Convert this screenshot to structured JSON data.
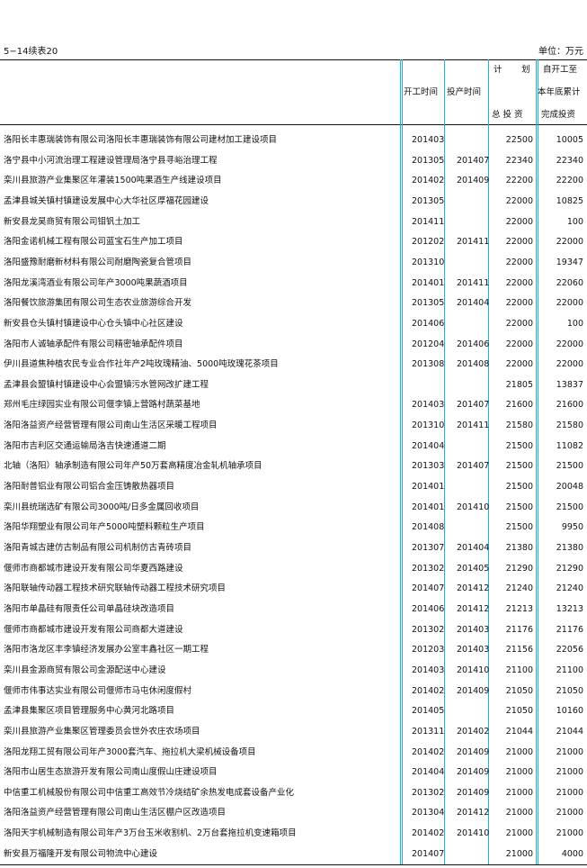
{
  "header": {
    "table_label": "5−14续表20",
    "unit_label": "单位：万元"
  },
  "columns": {
    "start_time": "开工时间",
    "production_time": "投产时间",
    "plan_char1": "计",
    "plan_char2": "划",
    "plan_sub": "总 投 资",
    "cum_line1": "自开工至",
    "cum_line2": "本年底累计",
    "cum_line3": "完成投资"
  },
  "rows": [
    {
      "name": "洛阳长丰惠瑞装饰有限公司洛阳长丰惠瑞装饰有限公司建材加工建设项目",
      "start": "201403",
      "prod": "",
      "total": "22500",
      "done": "10005"
    },
    {
      "name": "洛宁县中小河流治理工程建设管理局洛宁县寻峪治理工程",
      "start": "201305",
      "prod": "201407",
      "total": "22340",
      "done": "22340"
    },
    {
      "name": "栾川县旅游产业集聚区年灌装1500吨果酒生产线建设项目",
      "start": "201402",
      "prod": "201409",
      "total": "22200",
      "done": "22200"
    },
    {
      "name": "孟津县城关镇村镇建设发展中心大华社区厚福花园建设",
      "start": "201305",
      "prod": "",
      "total": "22000",
      "done": "10825"
    },
    {
      "name": "新安县龙昊商贸有限公司钼钒土加工",
      "start": "201411",
      "prod": "",
      "total": "22000",
      "done": "100"
    },
    {
      "name": "洛阳金诺机械工程有限公司蓝宝石生产加工项目",
      "start": "201202",
      "prod": "201411",
      "total": "22000",
      "done": "22000"
    },
    {
      "name": "洛阳盛豫耐磨新材料有限公司耐磨陶瓷复合管项目",
      "start": "201310",
      "prod": "",
      "total": "22000",
      "done": "19347"
    },
    {
      "name": "洛阳龙溪湾酒业有限公司年产3000吨果蔬酒项目",
      "start": "201401",
      "prod": "201411",
      "total": "22000",
      "done": "22060"
    },
    {
      "name": "洛阳餐饮旅游集团有限公司生态农业旅游综合开发",
      "start": "201305",
      "prod": "201404",
      "total": "22000",
      "done": "22000"
    },
    {
      "name": "新安县仓头镇村镇建设中心仓头镇中心社区建设",
      "start": "201406",
      "prod": "",
      "total": "22000",
      "done": "100"
    },
    {
      "name": "洛阳市人诚轴承配件有限公司精密轴承配件项目",
      "start": "201204",
      "prod": "201406",
      "total": "22000",
      "done": "22000"
    },
    {
      "name": "伊川县道焦种植农民专业合作社年产2吨玫瑰精油、5000吨玫瑰花茶项目",
      "start": "201308",
      "prod": "201408",
      "total": "22000",
      "done": "22000"
    },
    {
      "name": "孟津县会盟镇村镇建设中心会盟镇污水管网改扩建工程",
      "start": "",
      "prod": "",
      "total": "21805",
      "done": "13837"
    },
    {
      "name": "郑州毛庄绿园实业有限公司偃李镇上营路村蔬菜基地",
      "start": "201403",
      "prod": "201407",
      "total": "21600",
      "done": "21600"
    },
    {
      "name": "洛阳洛益资产经营管理有限公司南山生活区采暖工程项目",
      "start": "201310",
      "prod": "201411",
      "total": "21580",
      "done": "21580"
    },
    {
      "name": "洛阳市吉利区交通运输局洛吉快速通道二期",
      "start": "201404",
      "prod": "",
      "total": "21500",
      "done": "11082"
    },
    {
      "name": "北轴（洛阳）轴承制造有限公司年产50万套高精度冶金轧机轴承项目",
      "start": "201303",
      "prod": "201407",
      "total": "21500",
      "done": "21500"
    },
    {
      "name": "洛阳耐普铝业有限公司铝合金压铸散热器项目",
      "start": "201401",
      "prod": "",
      "total": "21500",
      "done": "20048"
    },
    {
      "name": "栾川县统瑞选矿有限公司3000吨/日多金属回收项目",
      "start": "201401",
      "prod": "201410",
      "total": "21500",
      "done": "21500"
    },
    {
      "name": "洛阳华翔塑业有限公司年产5000吨塑料颗粒生产项目",
      "start": "201408",
      "prod": "",
      "total": "21500",
      "done": "9950"
    },
    {
      "name": "洛阳青城古建仿古制品有限公司机制仿古青砖项目",
      "start": "201307",
      "prod": "201404",
      "total": "21380",
      "done": "21380"
    },
    {
      "name": "偃师市商都城市建设开发有限公司华夏西路建设",
      "start": "201302",
      "prod": "201405",
      "total": "21290",
      "done": "21290"
    },
    {
      "name": "洛阳联轴传动器工程技术研究联轴传动器工程技术研究项目",
      "start": "201407",
      "prod": "201412",
      "total": "21240",
      "done": "21240"
    },
    {
      "name": "洛阳市单晶硅有限责任公司单晶硅块改造项目",
      "start": "201406",
      "prod": "201412",
      "total": "21213",
      "done": "13213"
    },
    {
      "name": "偃师市商都城市建设开发有限公司商都大道建设",
      "start": "201302",
      "prod": "201403",
      "total": "21176",
      "done": "21176"
    },
    {
      "name": "洛阳市洛龙区丰李镇经济发展办公室丰鑫社区一期工程",
      "start": "201203",
      "prod": "201403",
      "total": "21156",
      "done": "22056"
    },
    {
      "name": "栾川县金源商贸有限公司金源配送中心建设",
      "start": "201403",
      "prod": "201410",
      "total": "21100",
      "done": "21100"
    },
    {
      "name": "偃师市伟事达实业有限公司偃师市马屯休闲度假村",
      "start": "201402",
      "prod": "201409",
      "total": "21050",
      "done": "21050"
    },
    {
      "name": "孟津县集聚区项目管理服务中心黄河北路项目",
      "start": "201405",
      "prod": "",
      "total": "21050",
      "done": "10160"
    },
    {
      "name": "栾川县旅游产业集聚区管理委员会世外农庄农场项目",
      "start": "201311",
      "prod": "201402",
      "total": "21044",
      "done": "21044"
    },
    {
      "name": "洛阳龙翔工贸有限公司年产3000套汽车、拖拉机大梁机械设备项目",
      "start": "201402",
      "prod": "201409",
      "total": "21000",
      "done": "21000"
    },
    {
      "name": "洛阳市山居生态旅游开发有限公司南山度假山庄建设项目",
      "start": "201404",
      "prod": "201409",
      "total": "21000",
      "done": "21000"
    },
    {
      "name": "中信重工机械股份有限公司中信重工高效节冷烧结矿余热发电成套设备产业化",
      "start": "201302",
      "prod": "201409",
      "total": "21000",
      "done": "21000"
    },
    {
      "name": "洛阳洛益资产经营管理有限公司南山生活区棚户区改造项目",
      "start": "201304",
      "prod": "201412",
      "total": "21000",
      "done": "21000"
    },
    {
      "name": "洛阳天宇机械制造有限公司年产3万台玉米收割机、2万台套拖拉机变速箱项目",
      "start": "201402",
      "prod": "201410",
      "total": "21000",
      "done": "21000"
    },
    {
      "name": "新安县万福隆开发有限公司物流中心建设",
      "start": "201407",
      "prod": "",
      "total": "21000",
      "done": "4000"
    }
  ]
}
